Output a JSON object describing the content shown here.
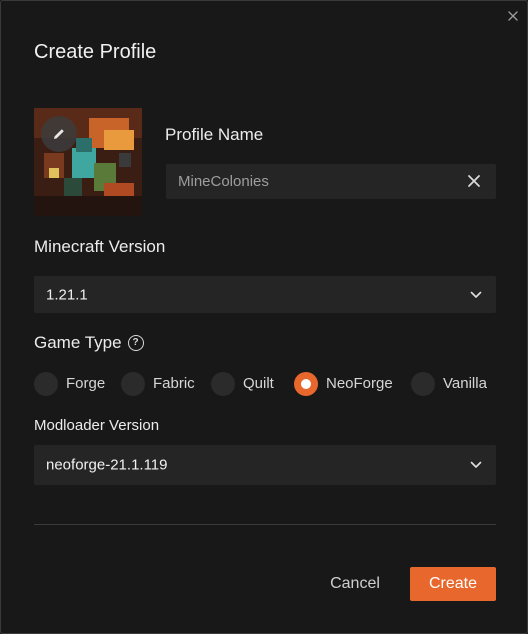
{
  "dialog": {
    "title": "Create Profile",
    "close_icon": "close-icon"
  },
  "profile": {
    "label": "Profile Name",
    "value": "MineColonies",
    "clear_icon": "clear-icon",
    "avatar_edit_icon": "pencil-icon"
  },
  "minecraft": {
    "label": "Minecraft Version",
    "value": "1.21.1"
  },
  "game_type": {
    "label": "Game Type",
    "help_glyph": "?",
    "options": [
      "Forge",
      "Fabric",
      "Quilt",
      "NeoForge",
      "Vanilla"
    ],
    "selected": "NeoForge"
  },
  "modloader": {
    "label": "Modloader Version",
    "value": "neoforge-21.1.119"
  },
  "actions": {
    "cancel_label": "Cancel",
    "create_label": "Create"
  },
  "colors": {
    "accent": "#e8672d",
    "background": "#181818",
    "field": "#252525"
  }
}
